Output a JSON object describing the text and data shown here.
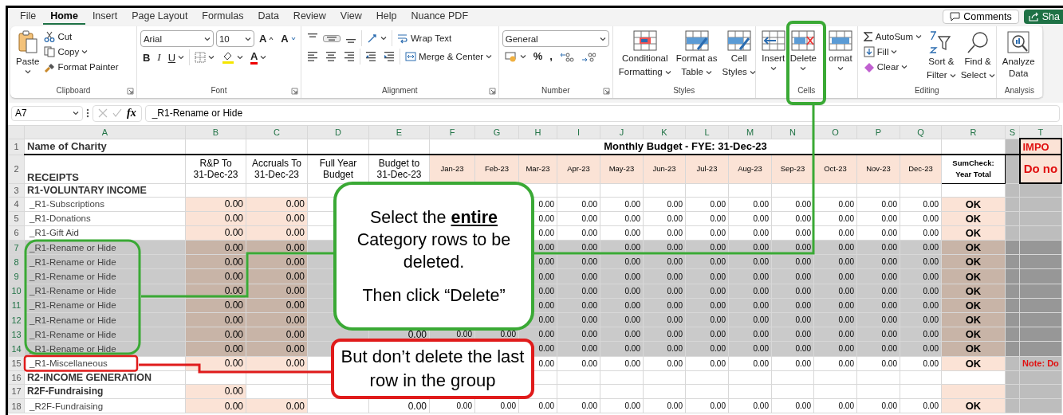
{
  "ribbon": {
    "tabs": [
      {
        "label": "File",
        "selected": false
      },
      {
        "label": "Home",
        "selected": true
      },
      {
        "label": "Insert",
        "selected": false
      },
      {
        "label": "Page Layout",
        "selected": false
      },
      {
        "label": "Formulas",
        "selected": false
      },
      {
        "label": "Data",
        "selected": false
      },
      {
        "label": "Review",
        "selected": false
      },
      {
        "label": "View",
        "selected": false
      },
      {
        "label": "Help",
        "selected": false
      },
      {
        "label": "Nuance PDF",
        "selected": false
      }
    ],
    "comments_button": "Comments",
    "share_button": "Sha",
    "groups": [
      {
        "kind": "clipboard",
        "label": "Clipboard",
        "dialog_launcher": true,
        "paste": "Paste",
        "cut": "Cut",
        "copy": "Copy",
        "format_painter": "Format Painter"
      },
      {
        "kind": "font",
        "label": "Font",
        "dialog_launcher": true,
        "font_name": "Arial",
        "font_size": "10",
        "grow": "A",
        "shrink": "A",
        "bold": "B",
        "italic": "I",
        "underline": "U",
        "font_color": "A"
      },
      {
        "kind": "alignment",
        "label": "Alignment",
        "dialog_launcher": true,
        "wrap_text": "Wrap Text",
        "merge_center": "Merge & Center"
      },
      {
        "kind": "number",
        "label": "Number",
        "dialog_launcher": true,
        "format": "General",
        "percent": "%",
        "comma": ","
      },
      {
        "kind": "styles",
        "label": "Styles",
        "dialog_launcher": false,
        "buttons": [
          [
            "Conditional",
            "Formatting"
          ],
          [
            "Format as",
            "Table"
          ],
          [
            "Cell",
            "Styles"
          ]
        ]
      },
      {
        "kind": "cells",
        "label": "Cells",
        "dialog_launcher": false,
        "buttons": [
          "Insert",
          "Delete",
          "ormat"
        ]
      },
      {
        "kind": "editing",
        "label": "Editing",
        "dialog_launcher": false,
        "autosum": "AutoSum",
        "fill": "Fill",
        "clear": "Clear",
        "buttons": [
          [
            "Sort &",
            "Filter"
          ],
          [
            "Find &",
            "Select"
          ]
        ]
      },
      {
        "kind": "analysis",
        "label": "Analysis",
        "dialog_launcher": false,
        "buttons": [
          [
            "Analyze",
            "Data"
          ]
        ]
      }
    ]
  },
  "formula_bar": {
    "name_box": "A7",
    "function_label": "fx",
    "value": "_R1-Rename or Hide"
  },
  "sheet": {
    "columns": [
      "A",
      "B",
      "C",
      "D",
      "E",
      "F",
      "G",
      "H",
      "I",
      "J",
      "K",
      "L",
      "M",
      "N",
      "O",
      "P",
      "Q",
      "R",
      "S",
      "T"
    ],
    "rows": [
      {
        "number": "1",
        "kind": "title",
        "selected": false,
        "cells": {
          "A": "Name of Charity",
          "F": "Monthly Budget  -  FYE: 31-Dec-23",
          "T": "IMPO"
        }
      },
      {
        "number": "2",
        "kind": "header",
        "selected": false,
        "cells": {
          "A": "RECEIPTS",
          "B": "R&P To\n31-Dec-23",
          "C": "Accruals To\n31-Dec-23",
          "D": "Full Year\nBudget",
          "E": "Budget to\n31-Dec-23",
          "F": "Jan-23",
          "G": "Feb-23",
          "H": "Mar-23",
          "I": "Apr-23",
          "J": "May-23",
          "K": "Jun-23",
          "L": "Jul-23",
          "M": "Aug-23",
          "N": "Sep-23",
          "O": "Oct-23",
          "P": "Nov-23",
          "Q": "Dec-23",
          "R": "SumCheck:\nYear Total",
          "T": "Do no"
        }
      },
      {
        "number": "3",
        "kind": "section",
        "selected": false,
        "cells": {
          "A": "R1-VOLUNTARY INCOME"
        }
      },
      {
        "number": "4",
        "kind": "item",
        "selected": false,
        "cells": {
          "A": "_R1-Subscriptions",
          "B": "0.00",
          "C": "0.00",
          "H": "0.00",
          "I": "0.00",
          "J": "0.00",
          "K": "0.00",
          "L": "0.00",
          "M": "0.00",
          "N": "0.00",
          "O": "0.00",
          "P": "0.00",
          "Q": "0.00",
          "R": "OK"
        }
      },
      {
        "number": "5",
        "kind": "item",
        "selected": false,
        "cells": {
          "A": "_R1-Donations",
          "B": "0.00",
          "C": "0.00",
          "H": "0.00",
          "I": "0.00",
          "J": "0.00",
          "K": "0.00",
          "L": "0.00",
          "M": "0.00",
          "N": "0.00",
          "O": "0.00",
          "P": "0.00",
          "Q": "0.00",
          "R": "OK"
        }
      },
      {
        "number": "6",
        "kind": "item",
        "selected": false,
        "cells": {
          "A": "_R1-Gift Aid",
          "B": "0.00",
          "C": "0.00",
          "H": "0.00",
          "I": "0.00",
          "J": "0.00",
          "K": "0.00",
          "L": "0.00",
          "M": "0.00",
          "N": "0.00",
          "O": "0.00",
          "P": "0.00",
          "Q": "0.00",
          "R": "OK"
        }
      },
      {
        "number": "7",
        "kind": "item",
        "selected": true,
        "cells": {
          "A": "_R1-Rename or Hide",
          "B": "0.00",
          "C": "0.00",
          "H": "0.00",
          "I": "0.00",
          "J": "0.00",
          "K": "0.00",
          "L": "0.00",
          "M": "0.00",
          "N": "0.00",
          "O": "0.00",
          "P": "0.00",
          "Q": "0.00",
          "R": "OK"
        }
      },
      {
        "number": "8",
        "kind": "item",
        "selected": true,
        "cells": {
          "A": "_R1-Rename or Hide",
          "B": "0.00",
          "C": "0.00",
          "H": "0.00",
          "I": "0.00",
          "J": "0.00",
          "K": "0.00",
          "L": "0.00",
          "M": "0.00",
          "N": "0.00",
          "O": "0.00",
          "P": "0.00",
          "Q": "0.00",
          "R": "OK"
        }
      },
      {
        "number": "9",
        "kind": "item",
        "selected": true,
        "cells": {
          "A": "_R1-Rename or Hide",
          "B": "0.00",
          "C": "0.00",
          "H": "0.00",
          "I": "0.00",
          "J": "0.00",
          "K": "0.00",
          "L": "0.00",
          "M": "0.00",
          "N": "0.00",
          "O": "0.00",
          "P": "0.00",
          "Q": "0.00",
          "R": "OK"
        }
      },
      {
        "number": "10",
        "kind": "item",
        "selected": true,
        "cells": {
          "A": "_R1-Rename or Hide",
          "B": "0.00",
          "C": "0.00",
          "H": "0.00",
          "I": "0.00",
          "J": "0.00",
          "K": "0.00",
          "L": "0.00",
          "M": "0.00",
          "N": "0.00",
          "O": "0.00",
          "P": "0.00",
          "Q": "0.00",
          "R": "OK"
        }
      },
      {
        "number": "11",
        "kind": "item",
        "selected": true,
        "cells": {
          "A": "_R1-Rename or Hide",
          "B": "0.00",
          "C": "0.00",
          "H": "0.00",
          "I": "0.00",
          "J": "0.00",
          "K": "0.00",
          "L": "0.00",
          "M": "0.00",
          "N": "0.00",
          "O": "0.00",
          "P": "0.00",
          "Q": "0.00",
          "R": "OK"
        }
      },
      {
        "number": "12",
        "kind": "item",
        "selected": true,
        "cells": {
          "A": "_R1-Rename or Hide",
          "B": "0.00",
          "C": "0.00",
          "H": "0.00",
          "I": "0.00",
          "J": "0.00",
          "K": "0.00",
          "L": "0.00",
          "M": "0.00",
          "N": "0.00",
          "O": "0.00",
          "P": "0.00",
          "Q": "0.00",
          "R": "OK"
        }
      },
      {
        "number": "13",
        "kind": "item",
        "selected": true,
        "cells": {
          "A": "_R1-Rename or Hide",
          "B": "0.00",
          "C": "0.00",
          "E": "0.00",
          "F": "0.00",
          "G": "0.00",
          "H": "0.00",
          "I": "0.00",
          "J": "0.00",
          "K": "0.00",
          "L": "0.00",
          "M": "0.00",
          "N": "0.00",
          "O": "0.00",
          "P": "0.00",
          "Q": "0.00",
          "R": "OK"
        }
      },
      {
        "number": "14",
        "kind": "item",
        "selected": true,
        "cells": {
          "A": "_R1-Rename or Hide",
          "B": "0.00",
          "C": "0.00",
          "H": "0.00",
          "I": "0.00",
          "J": "0.00",
          "K": "0.00",
          "L": "0.00",
          "M": "0.00",
          "N": "0.00",
          "O": "0.00",
          "P": "0.00",
          "Q": "0.00",
          "R": "OK"
        }
      },
      {
        "number": "15",
        "kind": "item",
        "selected": false,
        "cells": {
          "A": "_R1-Miscellaneous",
          "B": "0.00",
          "C": "0.00",
          "H": "0.00",
          "I": "0.00",
          "J": "0.00",
          "K": "0.00",
          "L": "0.00",
          "M": "0.00",
          "N": "0.00",
          "O": "0.00",
          "P": "0.00",
          "Q": "0.00",
          "R": "OK",
          "T": "Note:  Do"
        }
      },
      {
        "number": "16",
        "kind": "section",
        "selected": false,
        "cells": {
          "A": "R2-INCOME GENERATION"
        }
      },
      {
        "number": "17",
        "kind": "group",
        "selected": false,
        "cells": {
          "A": "R2F-Fundraising",
          "B": "0.00"
        }
      },
      {
        "number": "18",
        "kind": "item",
        "selected": false,
        "cells": {
          "A": "_R2F-Fundraising",
          "B": "0.00",
          "C": "0.00",
          "E": "0.00",
          "F": "0.00",
          "G": "0.00",
          "H": "0.00",
          "I": "0.00",
          "J": "0.00",
          "K": "0.00",
          "L": "0.00",
          "M": "0.00",
          "N": "0.00",
          "O": "0.00",
          "P": "0.00",
          "Q": "0.00",
          "R": "OK"
        }
      }
    ]
  },
  "callouts": [
    {
      "kind": "green",
      "paragraphs": [
        "Select the **entire** Category rows to be deleted.",
        "Then click “Delete”"
      ]
    },
    {
      "kind": "red",
      "paragraphs": [
        "But don’t delete the last row in the group"
      ]
    }
  ]
}
